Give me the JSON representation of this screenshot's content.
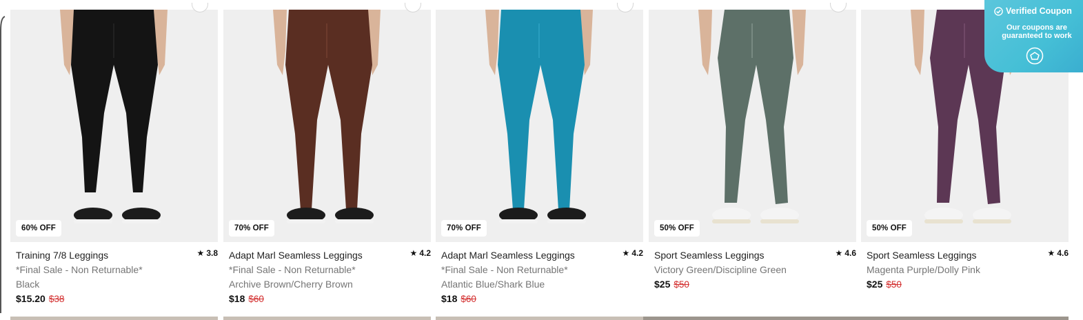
{
  "products": [
    {
      "badge": "60% OFF",
      "title": "Training 7/8 Leggings",
      "rating": "3.8",
      "line2": "*Final Sale - Non Returnable*",
      "color": "Black",
      "price": "$15.20",
      "original_price": "$38",
      "legging_color": "#141414",
      "legging_highlight": "#2a2a2a"
    },
    {
      "badge": "70% OFF",
      "title": "Adapt Marl Seamless Leggings",
      "rating": "4.2",
      "line2": "*Final Sale - Non Returnable*",
      "color": "Archive Brown/Cherry Brown",
      "price": "$18",
      "original_price": "$60",
      "legging_color": "#5a2e22",
      "legging_highlight": "#7a4434"
    },
    {
      "badge": "70% OFF",
      "title": "Adapt Marl Seamless Leggings",
      "rating": "4.2",
      "line2": "*Final Sale - Non Returnable*",
      "color": "Atlantic Blue/Shark Blue",
      "price": "$18",
      "original_price": "$60",
      "legging_color": "#1a8fb0",
      "legging_highlight": "#34a9c9"
    },
    {
      "badge": "50% OFF",
      "title": "Sport Seamless Leggings",
      "rating": "4.6",
      "line2": "Victory Green/Discipline Green",
      "color": "",
      "price": "$25",
      "original_price": "$50",
      "legging_color": "#5d7068",
      "legging_highlight": "#8a9c94"
    },
    {
      "badge": "50% OFF",
      "title": "Sport Seamless Leggings",
      "rating": "4.6",
      "line2": "Magenta Purple/Dolly Pink",
      "color": "",
      "price": "$25",
      "original_price": "$50",
      "legging_color": "#5c3754",
      "legging_highlight": "#7e5474"
    }
  ],
  "coupon": {
    "title": "Verified Coupon",
    "subtitle": "Our coupons are guaranteed to work",
    "icon": "coupon-logo-icon"
  },
  "colors": {
    "sale_price": "#d32f2f",
    "coupon_bg": "#45bfd6",
    "image_bg": "#efefef"
  }
}
